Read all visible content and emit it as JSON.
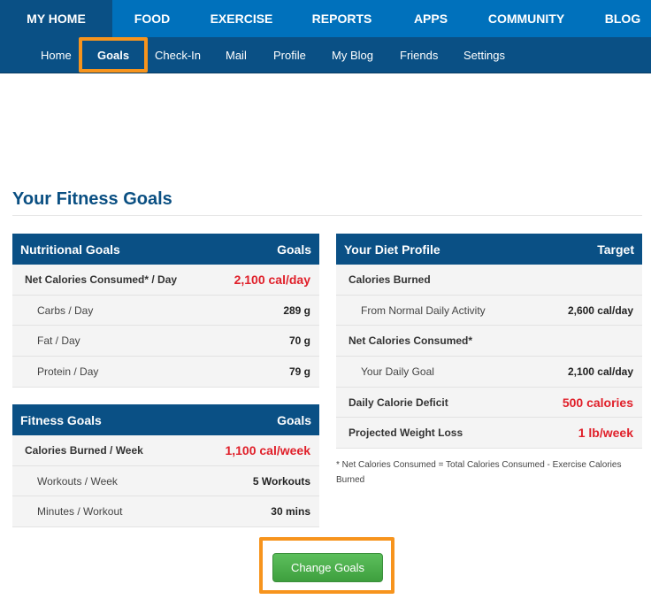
{
  "topnav": {
    "items": [
      "MY HOME",
      "FOOD",
      "EXERCISE",
      "REPORTS",
      "APPS",
      "COMMUNITY",
      "BLOG"
    ],
    "active": "MY HOME"
  },
  "subnav": {
    "items": [
      "Home",
      "Goals",
      "Check-In",
      "Mail",
      "Profile",
      "My Blog",
      "Friends",
      "Settings"
    ],
    "active": "Goals"
  },
  "page": {
    "title": "Your Fitness Goals"
  },
  "nutritional_goals": {
    "header": "Nutritional Goals",
    "col": "Goals",
    "rows": [
      {
        "label": "Net Calories Consumed* / Day",
        "value": "2,100 cal/day"
      },
      {
        "label": "Carbs / Day",
        "value": "289 g"
      },
      {
        "label": "Fat / Day",
        "value": "70 g"
      },
      {
        "label": "Protein / Day",
        "value": "79 g"
      }
    ]
  },
  "fitness_goals": {
    "header": "Fitness Goals",
    "col": "Goals",
    "rows": [
      {
        "label": "Calories Burned / Week",
        "value": "1,100 cal/week"
      },
      {
        "label": "Workouts / Week",
        "value": "5 Workouts"
      },
      {
        "label": "Minutes / Workout",
        "value": "30 mins"
      }
    ]
  },
  "diet_profile": {
    "header": "Your Diet Profile",
    "col": "Target",
    "rows": [
      {
        "label": "Calories Burned",
        "value": ""
      },
      {
        "label": "From Normal Daily Activity",
        "value": "2,600 cal/day"
      },
      {
        "label": "Net Calories Consumed*",
        "value": ""
      },
      {
        "label": "Your Daily Goal",
        "value": "2,100 cal/day"
      },
      {
        "label": "Daily Calorie Deficit",
        "value": "500 calories"
      },
      {
        "label": "Projected Weight Loss",
        "value": "1 lb/week"
      }
    ],
    "note": "* Net Calories Consumed = Total Calories Consumed - Exercise Calories Burned"
  },
  "actions": {
    "change_goals": "Change Goals"
  },
  "colors": {
    "nav_blue": "#0071bc",
    "dark_blue": "#0a5085",
    "highlight": "#f7941d",
    "red": "#e0202a",
    "green": "#4caf50"
  }
}
